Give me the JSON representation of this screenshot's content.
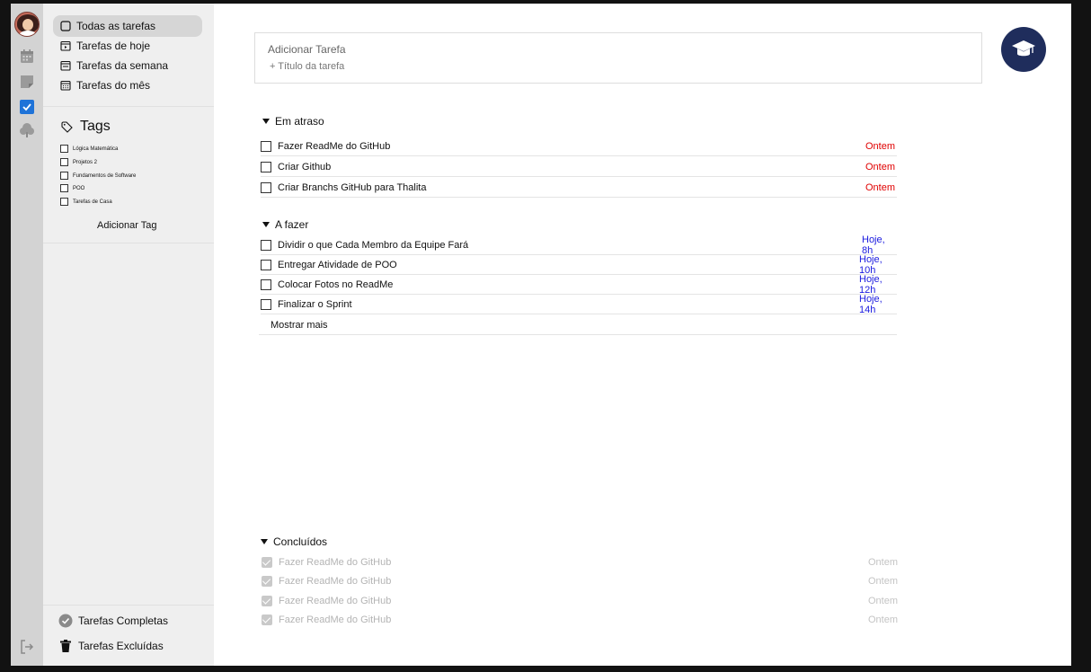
{
  "sidebar": {
    "nav": [
      {
        "label": "Todas as tarefas",
        "active": true
      },
      {
        "label": "Tarefas de hoje"
      },
      {
        "label": "Tarefas da semana"
      },
      {
        "label": "Tarefas do mês"
      }
    ],
    "tags_title": "Tags",
    "tags": [
      "Lógica Matemática",
      "Projetos 2",
      "Fundamentos de Software",
      "POO",
      "Tarefas de Casa"
    ],
    "add_tag": "Adicionar Tag",
    "completed": "Tarefas Completas",
    "deleted": "Tarefas Excluídas"
  },
  "add_task": {
    "title": "Adicionar Tarefa",
    "placeholder": "+ Título da tarefa"
  },
  "sections": {
    "overdue": {
      "title": "Em atraso",
      "tasks": [
        {
          "label": "Fazer ReadMe do GitHub",
          "due": "Ontem"
        },
        {
          "label": "Criar Github",
          "due": "Ontem"
        },
        {
          "label": "Criar Branchs GitHub para Thalita",
          "due": "Ontem"
        }
      ]
    },
    "todo": {
      "title": "A fazer",
      "tasks": [
        {
          "label": "Dividir o que Cada Membro da Equipe Fará",
          "due": "Hoje, 8h"
        },
        {
          "label": "Entregar Atividade de POO",
          "due": "Hoje, 10h"
        },
        {
          "label": "Colocar Fotos no ReadMe",
          "due": "Hoje, 12h"
        },
        {
          "label": "Finalizar o Sprint",
          "due": "Hoje, 14h"
        }
      ],
      "show_more": "Mostrar mais"
    },
    "done": {
      "title": "Concluídos",
      "tasks": [
        {
          "label": "Fazer ReadMe do GitHub",
          "due": "Ontem"
        },
        {
          "label": "Fazer ReadMe do GitHub",
          "due": "Ontem"
        },
        {
          "label": "Fazer ReadMe do GitHub",
          "due": "Ontem"
        },
        {
          "label": "Fazer ReadMe do GitHub",
          "due": "Ontem"
        }
      ]
    }
  },
  "colors": {
    "overdue": "#e00000",
    "today": "#1a1adf",
    "badge": "#1f2d5c",
    "rail_check": "#1f73d8"
  },
  "icons": [
    "user-avatar",
    "calendar-icon",
    "note-icon",
    "checkbox-icon",
    "tree-icon",
    "logout-icon",
    "graduation-cap-icon",
    "tag-icon",
    "trash-icon"
  ]
}
